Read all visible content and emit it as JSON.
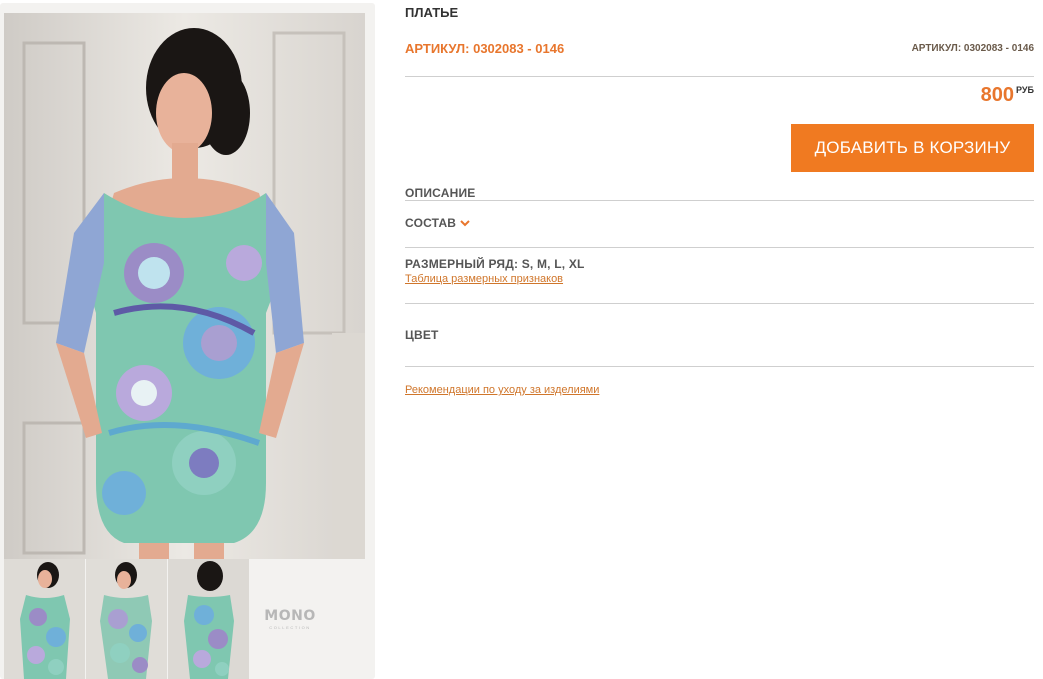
{
  "product": {
    "title": "ПЛАТЬЕ",
    "sku_label": "АРТИКУЛ: 0302083 - 0146",
    "sku_small": "АРТИКУЛ: 0302083 - 0146",
    "price": "800",
    "currency": "РУБ",
    "add_to_cart": "ДОБАВИТЬ В КОРЗИНУ"
  },
  "sections": {
    "description": "ОПИСАНИЕ",
    "composition": "СОСТАВ",
    "sizes": "РАЗМЕРНЫЙ РЯД: S, M, L, XL",
    "size_table_link": "Таблица размерных признаков",
    "color": "ЦВЕТ",
    "care_link": "Рекомендации по уходу за изделиями"
  },
  "gallery": {
    "logo_word": "MONO",
    "logo_sub": "COLLECTION"
  },
  "colors": {
    "accent": "#f07a21",
    "accent_text": "#e8762d"
  }
}
